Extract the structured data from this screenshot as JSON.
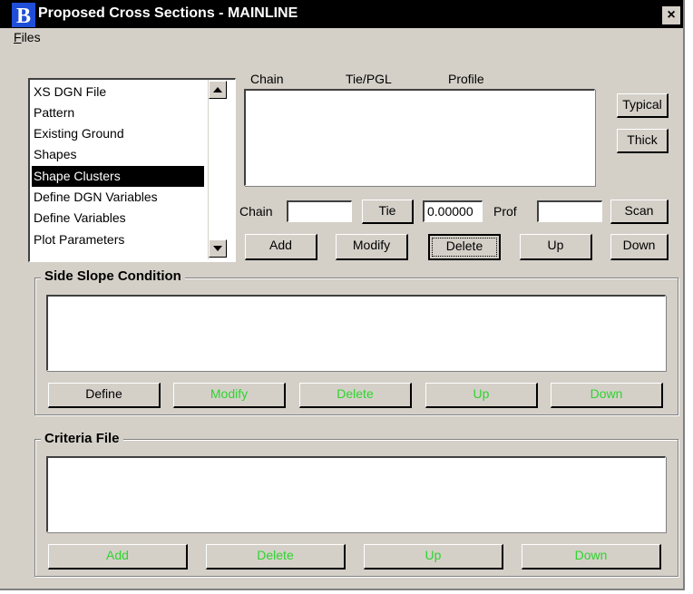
{
  "window": {
    "title": "Proposed Cross Sections - MAINLINE",
    "close_glyph": "×",
    "accent_color": "#000000",
    "disabled_text_color": "#2fd32f"
  },
  "menu": {
    "files_label": "Files"
  },
  "category_list": {
    "items": [
      {
        "label": "XS DGN File",
        "selected": false
      },
      {
        "label": "Pattern",
        "selected": false
      },
      {
        "label": "Existing Ground",
        "selected": false
      },
      {
        "label": "Shapes",
        "selected": false
      },
      {
        "label": "Shape Clusters",
        "selected": true
      },
      {
        "label": "Define DGN Variables",
        "selected": false
      },
      {
        "label": "Define Variables",
        "selected": false
      },
      {
        "label": "Plot Parameters",
        "selected": false
      }
    ]
  },
  "shape_clusters": {
    "columns": [
      "Chain",
      "Tie/PGL",
      "Profile"
    ],
    "typical_label": "Typical",
    "thick_label": "Thick",
    "chain_label": "Chain",
    "chain_value": "",
    "tie_label": "Tie",
    "tie_value": "0.00000",
    "prof_label": "Prof",
    "prof_value": "",
    "scan_label": "Scan",
    "add_label": "Add",
    "modify_label": "Modify",
    "delete_label": "Delete",
    "up_label": "Up",
    "down_label": "Down"
  },
  "side_slope": {
    "title": "Side Slope Condition",
    "define_label": "Define",
    "modify_label": "Modify",
    "delete_label": "Delete",
    "up_label": "Up",
    "down_label": "Down"
  },
  "criteria": {
    "title": "Criteria File",
    "add_label": "Add",
    "delete_label": "Delete",
    "up_label": "Up",
    "down_label": "Down"
  }
}
